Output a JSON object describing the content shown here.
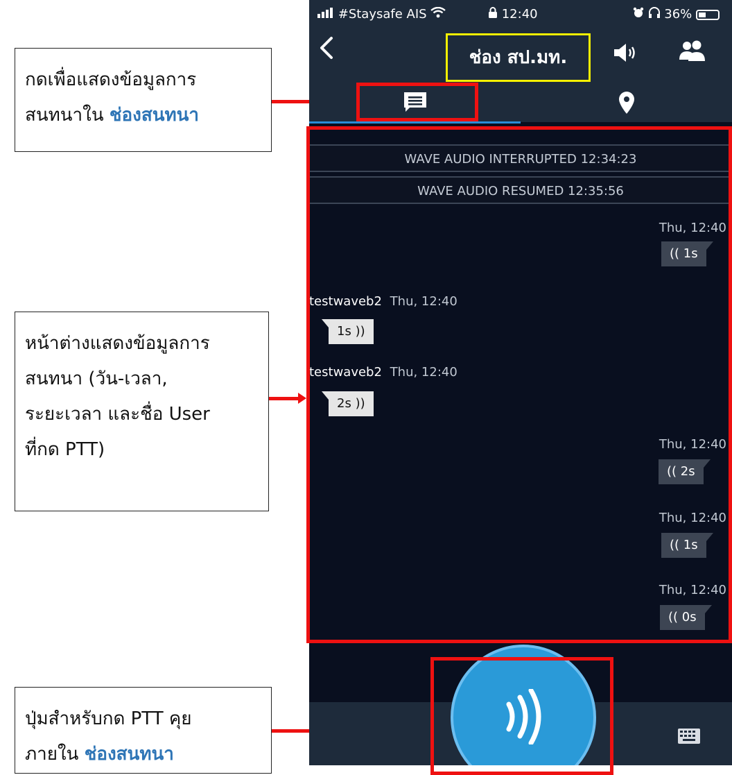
{
  "annotations": {
    "box1": {
      "line1": "กดเพื่อแสดงข้อมูลการ",
      "line2_prefix": "สนทนาใน ",
      "line2_highlight": "ช่องสนทนา"
    },
    "box2": {
      "line1": "หน้าต่างแสดงข้อมูลการ",
      "line2": "สนทนา (วัน-เวลา,",
      "line3": "ระยะเวลา และชื่อ User",
      "line4": "ที่กด PTT)"
    },
    "box3": {
      "line1": "ปุ่มสำหรับกด PTT คุย",
      "line2_prefix": "ภายใน ",
      "line2_highlight": "ช่องสนทนา"
    }
  },
  "status_bar": {
    "carrier": "#Staysafe AIS",
    "time": "12:40",
    "battery": "36%"
  },
  "header": {
    "channel_title": "ช่อง สป.มท."
  },
  "tabs": [
    {
      "name": "chat",
      "icon": "chat-icon",
      "active": true
    },
    {
      "name": "map",
      "icon": "location-pin-icon",
      "active": false
    }
  ],
  "system_messages": [
    "WAVE AUDIO INTERRUPTED 12:34:23",
    "WAVE AUDIO RESUMED 12:35:56"
  ],
  "messages": {
    "m1": {
      "direction": "outgoing",
      "timestamp": "Thu, 12:40",
      "duration": "1s"
    },
    "m2": {
      "direction": "incoming",
      "sender": "testwaveb2",
      "timestamp": "Thu, 12:40",
      "duration": "1s"
    },
    "m3": {
      "direction": "incoming",
      "sender": "testwaveb2",
      "timestamp": "Thu, 12:40",
      "duration": "2s"
    },
    "m4": {
      "direction": "outgoing",
      "timestamp": "Thu, 12:40",
      "duration": "2s"
    },
    "m5": {
      "direction": "outgoing",
      "timestamp": "Thu, 12:40",
      "duration": "1s"
    },
    "m6": {
      "direction": "outgoing",
      "timestamp": "Thu, 12:40",
      "duration": "0s"
    }
  },
  "colors": {
    "highlight_text": "#2e75b6",
    "annotation_red": "#ee1111",
    "title_outline": "#f6f000",
    "app_header": "#1e2b3b",
    "chat_background": "#090f1f",
    "ptt_button": "#2a9ad8"
  },
  "bottom": {
    "ptt_icon": "sound-waves-icon",
    "keyboard_icon": "keyboard-icon"
  }
}
